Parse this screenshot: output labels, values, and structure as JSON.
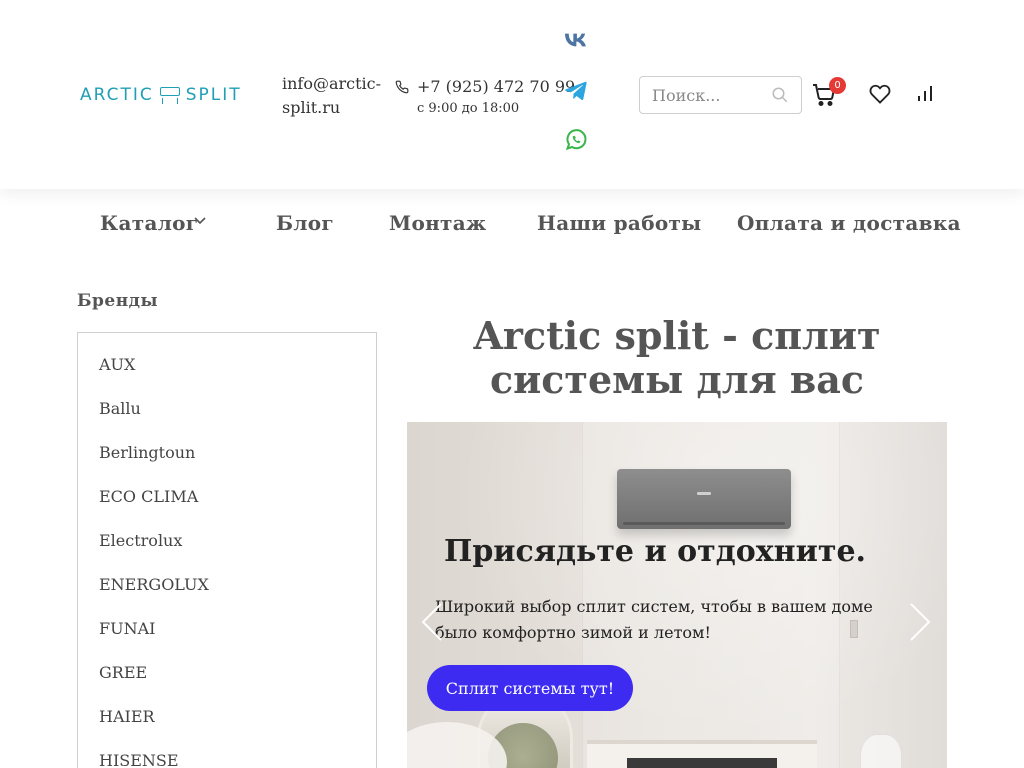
{
  "header": {
    "logo": {
      "left_word": "ARCTIC",
      "right_word": "SPLIT",
      "icon": "air-conditioner-icon"
    },
    "email": "info@arctic-split.ru",
    "phone": "+7 (925) 472 70 99",
    "hours": "с 9:00 до 18:00",
    "socials": [
      {
        "name": "vk",
        "icon": "vk-icon",
        "color": "#4c75a3"
      },
      {
        "name": "telegram",
        "icon": "telegram-icon",
        "color": "#2ca5e0"
      },
      {
        "name": "whatsapp",
        "icon": "whatsapp-icon",
        "color": "#3ab54a"
      }
    ],
    "search": {
      "placeholder": "Поиск...",
      "value": ""
    },
    "cart": {
      "count": "0"
    }
  },
  "nav": {
    "items": [
      {
        "label": "Каталог",
        "has_dropdown": true
      },
      {
        "label": "Блог"
      },
      {
        "label": "Монтаж"
      },
      {
        "label": "Наши работы"
      },
      {
        "label": "Оплата и доставка"
      }
    ]
  },
  "sidebar": {
    "title": "Бренды",
    "brands": [
      "AUX",
      "Ballu",
      "Berlingtoun",
      "ECO CLIMA",
      "Electrolux",
      "ENERGOLUX",
      "FUNAI",
      "GREE",
      "HAIER",
      "HISENSE"
    ]
  },
  "main": {
    "title": "Arctic split - сплит системы для вас",
    "hero": {
      "heading": "Присядьте и отдохните.",
      "text": "Широкий выбор сплит систем, чтобы в вашем доме было комфортно зимой и летом!",
      "button": "Сплит системы тут!"
    }
  },
  "colors": {
    "accent": "#3d2bf2",
    "logo": "#1f9fb5",
    "badge": "#e53935"
  }
}
